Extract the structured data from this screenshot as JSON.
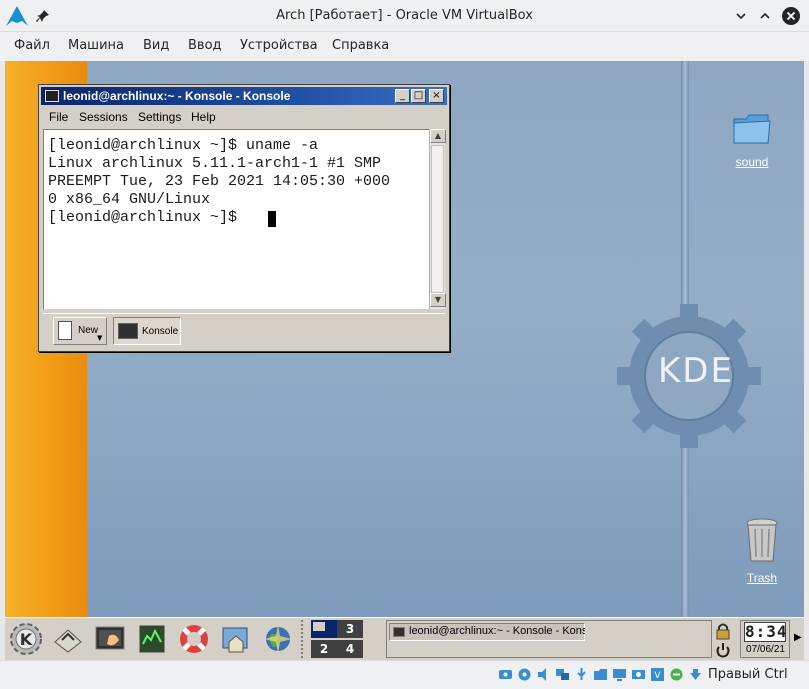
{
  "host": {
    "title": "Arch [Работает] - Oracle VM VirtualBox",
    "menu": [
      "Файл",
      "Машина",
      "Вид",
      "Ввод",
      "Устройства",
      "Справка"
    ],
    "status_host_key": "Правый Ctrl",
    "status_icons": [
      "hard-disk-icon",
      "optical-drive-icon",
      "audio-icon",
      "network-icon",
      "usb-icon",
      "shared-folders-icon",
      "display-icon",
      "video-capture-icon",
      "virtualization-icon",
      "mouse-integration-icon",
      "keyboard-icon"
    ]
  },
  "desktop": {
    "icons": [
      {
        "name": "sound-folder-icon",
        "label": "sound"
      },
      {
        "name": "trash-icon",
        "label": "Trash"
      }
    ],
    "logo_text": "KDE"
  },
  "konsole": {
    "title": "leonid@archlinux:~ - Konsole - Konsole",
    "window_buttons": [
      "_",
      "□",
      "×"
    ],
    "menu": [
      "File",
      "Sessions",
      "Settings",
      "Help"
    ],
    "terminal_lines": [
      "[leonid@archlinux ~]$ uname -a",
      "Linux archlinux 5.11.1-arch1-1 #1 SMP",
      "PREEMPT Tue, 23 Feb 2021 14:05:30 +000",
      "0 x86_64 GNU/Linux",
      "[leonid@archlinux ~]$ "
    ],
    "new_button_label": "New",
    "tab_label": "Konsole"
  },
  "taskbar": {
    "launchers": [
      "kde-menu-icon",
      "home-folder-icon",
      "konsole-shell-icon",
      "system-monitor-icon",
      "help-lifebuoy-icon",
      "file-manager-icon",
      "web-browser-icon"
    ],
    "pager": [
      "1",
      "3",
      "2",
      "4"
    ],
    "active_desktop": "1",
    "task_label": "leonid@archlinux:~ - Konsole - Konsole",
    "clock_time": "8:34",
    "clock_date": "07/06/21"
  },
  "colors": {
    "kde_stripe": "#f09a14",
    "desktop_blue": "#8ea7c3",
    "konsole_titlebar": "#0a246a",
    "pager_active": "#0a246a"
  }
}
